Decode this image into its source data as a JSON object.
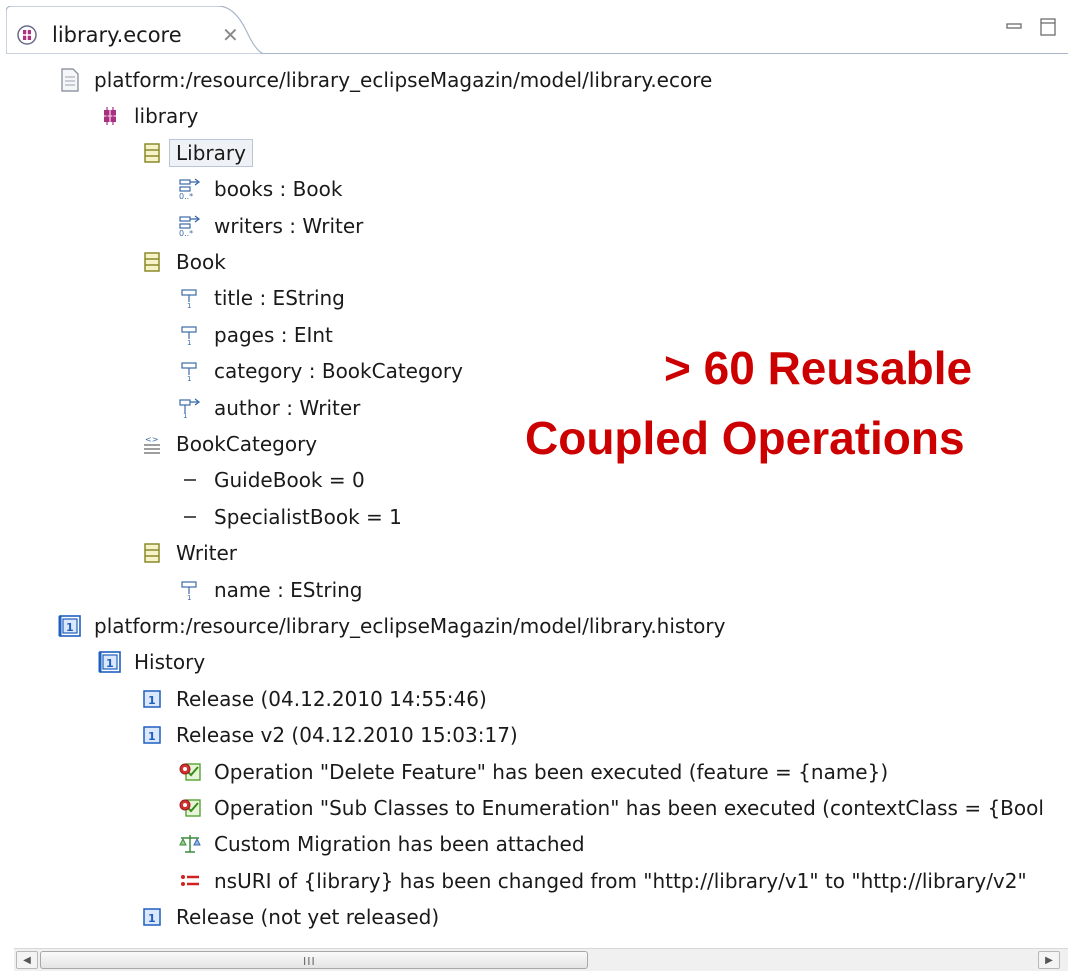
{
  "tab": {
    "label": "library.ecore",
    "close_glyph": "✕"
  },
  "overlay": {
    "line1": "> 60 Reusable",
    "line2": "Coupled Operations"
  },
  "tree": [
    {
      "name": "resource-ecore",
      "icon": "file-icon",
      "label": "platform:/resource/library_eclipseMagazin/model/library.ecore",
      "depth": 0
    },
    {
      "name": "package-library",
      "icon": "package-icon",
      "label": "library",
      "depth": 1
    },
    {
      "name": "class-library",
      "icon": "class-icon",
      "label": "Library",
      "depth": 2,
      "selected": true
    },
    {
      "name": "ref-books",
      "icon": "reference-many-icon",
      "label": "books : Book",
      "depth": 3
    },
    {
      "name": "ref-writers",
      "icon": "reference-many-icon",
      "label": "writers : Writer",
      "depth": 3
    },
    {
      "name": "class-book",
      "icon": "class-icon",
      "label": "Book",
      "depth": 2
    },
    {
      "name": "attr-title",
      "icon": "attribute-icon",
      "label": "title : EString",
      "depth": 3
    },
    {
      "name": "attr-pages",
      "icon": "attribute-icon",
      "label": "pages : EInt",
      "depth": 3
    },
    {
      "name": "attr-category",
      "icon": "attribute-icon",
      "label": "category : BookCategory",
      "depth": 3
    },
    {
      "name": "ref-author",
      "icon": "reference-icon",
      "label": "author : Writer",
      "depth": 3
    },
    {
      "name": "enum-bookcategory",
      "icon": "enum-icon",
      "label": "BookCategory",
      "depth": 2
    },
    {
      "name": "literal-guidebook",
      "icon": "literal-icon",
      "label": "GuideBook = 0",
      "depth": 3
    },
    {
      "name": "literal-specialistbook",
      "icon": "literal-icon",
      "label": "SpecialistBook = 1",
      "depth": 3
    },
    {
      "name": "class-writer",
      "icon": "class-icon",
      "label": "Writer",
      "depth": 2
    },
    {
      "name": "attr-name",
      "icon": "attribute-icon",
      "label": "name : EString",
      "depth": 3
    },
    {
      "name": "resource-history",
      "icon": "history-icon",
      "label": "platform:/resource/library_eclipseMagazin/model/library.history",
      "depth": 0
    },
    {
      "name": "history",
      "icon": "history-icon",
      "label": "History",
      "depth": 1
    },
    {
      "name": "release-1",
      "icon": "release-icon",
      "label": "Release (04.12.2010 14:55:46)",
      "depth": 2
    },
    {
      "name": "release-v2",
      "icon": "release-icon",
      "label": "Release v2 (04.12.2010 15:03:17)",
      "depth": 2
    },
    {
      "name": "op-delete-feature",
      "icon": "operation-icon",
      "label": "Operation \"Delete Feature\" has been executed (feature = {name})",
      "depth": 3
    },
    {
      "name": "op-subclasses-enum",
      "icon": "operation-icon",
      "label": "Operation \"Sub Classes to Enumeration\" has been executed (contextClass = {Bool",
      "depth": 3
    },
    {
      "name": "custom-migration",
      "icon": "migration-icon",
      "label": "Custom Migration has been attached",
      "depth": 3
    },
    {
      "name": "nsuri-change",
      "icon": "change-icon",
      "label": "nsURI of {library} has been changed from \"http://library/v1\" to \"http://library/v2\"",
      "depth": 3
    },
    {
      "name": "release-unreleased",
      "icon": "release-icon",
      "label": "Release (not yet released)",
      "depth": 2
    }
  ],
  "scrollbar": {
    "grip": "III"
  },
  "colors": {
    "overlay": "#cc0000",
    "history_blue": "#1f5fbf",
    "class_olive": "#8a8a2a"
  }
}
